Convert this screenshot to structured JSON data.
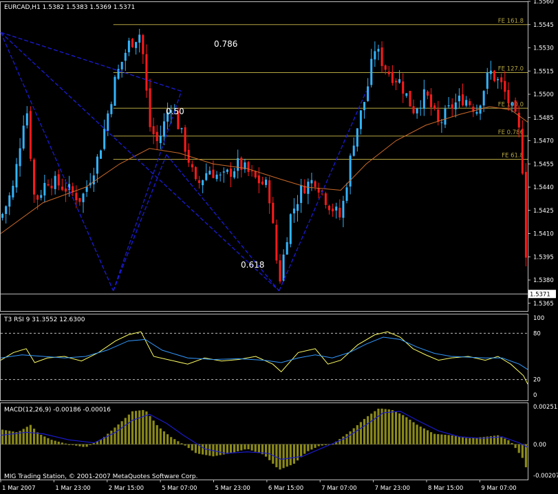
{
  "chart_data": {
    "type": "candlestick",
    "main": {
      "title": "EURCAD,H1  1.5382 1.5383 1.5369 1.5371",
      "ylim": [
        1.536,
        1.556
      ],
      "price_ticks": [
        "1.5560",
        "1.5545",
        "1.5530",
        "1.5515",
        "1.5500",
        "1.5485",
        "1.5470",
        "1.5455",
        "1.5440",
        "1.5425",
        "1.5410",
        "1.5395",
        "1.5380",
        "1.5365"
      ],
      "current_price": "1.5371",
      "fibo_levels": [
        {
          "label": "FE 161.8",
          "price": 1.5545
        },
        {
          "label": "FE 127.0",
          "price": 1.5514
        },
        {
          "label": "FE 100.0",
          "price": 1.5491
        },
        {
          "label": "FE 0.786",
          "price": 1.5473
        },
        {
          "label": "FE 61.8",
          "price": 1.5458
        }
      ],
      "ratio_labels": [
        "0.786",
        "0.50",
        "0.618"
      ],
      "pattern_points": [
        {
          "t": 0.0,
          "p": 1.554
        },
        {
          "t": 0.425,
          "p": 1.5502
        },
        {
          "t": 0.265,
          "p": 1.5373
        },
        {
          "t": 0.39,
          "p": 1.5461
        },
        {
          "t": 0.655,
          "p": 1.5373
        },
        {
          "t": 0.86,
          "p": 1.5502
        }
      ],
      "key_prices": [
        [
          0.0,
          1.542
        ],
        [
          0.03,
          1.544
        ],
        [
          0.06,
          1.5495
        ],
        [
          0.08,
          1.543
        ],
        [
          0.11,
          1.5445
        ],
        [
          0.15,
          1.544
        ],
        [
          0.19,
          1.5432
        ],
        [
          0.23,
          1.546
        ],
        [
          0.27,
          1.551
        ],
        [
          0.3,
          1.5532
        ],
        [
          0.33,
          1.554
        ],
        [
          0.35,
          1.548
        ],
        [
          0.37,
          1.5468
        ],
        [
          0.4,
          1.5495
        ],
        [
          0.43,
          1.547
        ],
        [
          0.46,
          1.544
        ],
        [
          0.49,
          1.5452
        ],
        [
          0.52,
          1.5445
        ],
        [
          0.56,
          1.5455
        ],
        [
          0.6,
          1.5445
        ],
        [
          0.63,
          1.544
        ],
        [
          0.655,
          1.5378
        ],
        [
          0.68,
          1.542
        ],
        [
          0.71,
          1.544
        ],
        [
          0.74,
          1.5445
        ],
        [
          0.77,
          1.543
        ],
        [
          0.8,
          1.542
        ],
        [
          0.83,
          1.547
        ],
        [
          0.86,
          1.55
        ],
        [
          0.88,
          1.553
        ],
        [
          0.91,
          1.5515
        ],
        [
          0.94,
          1.5508
        ],
        [
          0.97,
          1.549
        ],
        [
          1.0,
          1.55
        ],
        [
          1.03,
          1.548
        ],
        [
          1.06,
          1.5492
        ],
        [
          1.09,
          1.5498
        ],
        [
          1.12,
          1.549
        ],
        [
          1.15,
          1.5515
        ],
        [
          1.18,
          1.5505
        ],
        [
          1.21,
          1.5485
        ],
        [
          1.225,
          1.547
        ],
        [
          1.24,
          1.5371
        ]
      ],
      "ma_prices": [
        [
          0.0,
          1.541
        ],
        [
          0.1,
          1.543
        ],
        [
          0.2,
          1.544
        ],
        [
          0.28,
          1.5455
        ],
        [
          0.35,
          1.5465
        ],
        [
          0.42,
          1.5462
        ],
        [
          0.5,
          1.5455
        ],
        [
          0.58,
          1.5452
        ],
        [
          0.66,
          1.5445
        ],
        [
          0.72,
          1.544
        ],
        [
          0.8,
          1.5438
        ],
        [
          0.86,
          1.5455
        ],
        [
          0.93,
          1.547
        ],
        [
          1.0,
          1.548
        ],
        [
          1.08,
          1.5487
        ],
        [
          1.15,
          1.5492
        ],
        [
          1.2,
          1.549
        ],
        [
          1.24,
          1.5482
        ]
      ]
    },
    "rsi": {
      "label": "T3 RSI 9 31.3552 12.6300",
      "ylim": [
        0,
        100
      ],
      "ticks": [
        "100",
        "80",
        "20",
        "0"
      ],
      "levels": [
        80,
        20
      ],
      "fast": [
        [
          0.0,
          45
        ],
        [
          0.03,
          55
        ],
        [
          0.06,
          60
        ],
        [
          0.08,
          42
        ],
        [
          0.11,
          48
        ],
        [
          0.15,
          50
        ],
        [
          0.19,
          44
        ],
        [
          0.23,
          55
        ],
        [
          0.27,
          70
        ],
        [
          0.3,
          78
        ],
        [
          0.33,
          82
        ],
        [
          0.36,
          50
        ],
        [
          0.4,
          45
        ],
        [
          0.44,
          40
        ],
        [
          0.48,
          48
        ],
        [
          0.52,
          44
        ],
        [
          0.56,
          46
        ],
        [
          0.6,
          50
        ],
        [
          0.64,
          40
        ],
        [
          0.66,
          30
        ],
        [
          0.7,
          55
        ],
        [
          0.74,
          60
        ],
        [
          0.77,
          40
        ],
        [
          0.8,
          45
        ],
        [
          0.84,
          65
        ],
        [
          0.88,
          78
        ],
        [
          0.91,
          82
        ],
        [
          0.94,
          75
        ],
        [
          0.97,
          60
        ],
        [
          1.0,
          52
        ],
        [
          1.03,
          45
        ],
        [
          1.06,
          48
        ],
        [
          1.1,
          50
        ],
        [
          1.14,
          45
        ],
        [
          1.17,
          50
        ],
        [
          1.2,
          40
        ],
        [
          1.23,
          25
        ],
        [
          1.24,
          14
        ]
      ],
      "slow": [
        [
          0.0,
          48
        ],
        [
          0.05,
          52
        ],
        [
          0.1,
          50
        ],
        [
          0.15,
          48
        ],
        [
          0.2,
          50
        ],
        [
          0.25,
          58
        ],
        [
          0.3,
          70
        ],
        [
          0.34,
          72
        ],
        [
          0.38,
          58
        ],
        [
          0.44,
          48
        ],
        [
          0.5,
          46
        ],
        [
          0.56,
          47
        ],
        [
          0.62,
          45
        ],
        [
          0.66,
          42
        ],
        [
          0.7,
          48
        ],
        [
          0.74,
          52
        ],
        [
          0.78,
          48
        ],
        [
          0.82,
          55
        ],
        [
          0.86,
          66
        ],
        [
          0.9,
          75
        ],
        [
          0.94,
          72
        ],
        [
          0.98,
          62
        ],
        [
          1.02,
          54
        ],
        [
          1.06,
          50
        ],
        [
          1.1,
          49
        ],
        [
          1.14,
          48
        ],
        [
          1.18,
          48
        ],
        [
          1.22,
          40
        ],
        [
          1.24,
          33
        ]
      ]
    },
    "macd": {
      "label": "MACD(12,26,9) -0.00186 -0.00016",
      "ylim": [
        -0.00207,
        0.00251
      ],
      "ticks": [
        "0.00251",
        "0.00",
        "-0.00207"
      ],
      "hist": [
        [
          0.0,
          0.001
        ],
        [
          0.04,
          0.0008
        ],
        [
          0.07,
          0.0013
        ],
        [
          0.09,
          0.0007
        ],
        [
          0.12,
          0.0003
        ],
        [
          0.16,
          0.0
        ],
        [
          0.2,
          -0.0002
        ],
        [
          0.24,
          0.0004
        ],
        [
          0.28,
          0.0014
        ],
        [
          0.31,
          0.0022
        ],
        [
          0.34,
          0.0023
        ],
        [
          0.37,
          0.0012
        ],
        [
          0.4,
          0.0005
        ],
        [
          0.43,
          0.0
        ],
        [
          0.46,
          -0.0006
        ],
        [
          0.5,
          -0.0008
        ],
        [
          0.54,
          -0.0006
        ],
        [
          0.58,
          -0.0003
        ],
        [
          0.62,
          -0.0007
        ],
        [
          0.655,
          -0.0017
        ],
        [
          0.69,
          -0.0013
        ],
        [
          0.72,
          -0.0005
        ],
        [
          0.75,
          -0.0001
        ],
        [
          0.78,
          0.0
        ],
        [
          0.82,
          0.0008
        ],
        [
          0.86,
          0.0018
        ],
        [
          0.89,
          0.0024
        ],
        [
          0.92,
          0.0023
        ],
        [
          0.95,
          0.0019
        ],
        [
          0.98,
          0.0013
        ],
        [
          1.02,
          0.0007
        ],
        [
          1.06,
          0.0006
        ],
        [
          1.1,
          0.0004
        ],
        [
          1.14,
          0.0005
        ],
        [
          1.17,
          0.0006
        ],
        [
          1.2,
          0.0002
        ],
        [
          1.23,
          -0.001
        ],
        [
          1.24,
          -0.0019
        ]
      ],
      "signal": [
        [
          0.0,
          0.0006
        ],
        [
          0.06,
          0.0008
        ],
        [
          0.1,
          0.0007
        ],
        [
          0.16,
          0.0003
        ],
        [
          0.22,
          0.0001
        ],
        [
          0.27,
          0.0008
        ],
        [
          0.31,
          0.0016
        ],
        [
          0.35,
          0.002
        ],
        [
          0.39,
          0.0014
        ],
        [
          0.43,
          0.0006
        ],
        [
          0.48,
          -0.0003
        ],
        [
          0.53,
          -0.0006
        ],
        [
          0.58,
          -0.0005
        ],
        [
          0.63,
          -0.0006
        ],
        [
          0.66,
          -0.001
        ],
        [
          0.71,
          -0.0008
        ],
        [
          0.76,
          -0.0002
        ],
        [
          0.81,
          0.0004
        ],
        [
          0.86,
          0.0013
        ],
        [
          0.9,
          0.0021
        ],
        [
          0.94,
          0.0022
        ],
        [
          0.98,
          0.0016
        ],
        [
          1.03,
          0.0009
        ],
        [
          1.08,
          0.0005
        ],
        [
          1.13,
          0.0004
        ],
        [
          1.18,
          0.0005
        ],
        [
          1.22,
          0.0001
        ],
        [
          1.24,
          -0.0002
        ]
      ],
      "footer": "MIG Trading Station, © 2001-2007 MetaQuotes Software Corp."
    },
    "time_ticks": [
      "1 Mar 2007",
      "1 Mar 23:00",
      "2 Mar 15:00",
      "5 Mar 07:00",
      "5 Mar 23:00",
      "6 Mar 15:00",
      "7 Mar 07:00",
      "7 Mar 23:00",
      "8 Mar 15:00",
      "9 Mar 07:00"
    ],
    "colors": {
      "bull": "#33b5ff",
      "bear": "#ff1a1a",
      "fibo": "#b5a642",
      "ma": "#cc6a2a",
      "pattern": "#1a1acc",
      "rsi_fast": "#ffff66",
      "rsi_slow": "#3399ff",
      "macd_hist": "#8b8a1a",
      "macd_signal": "#1a1acc",
      "grid": "#c0c0c0"
    }
  }
}
